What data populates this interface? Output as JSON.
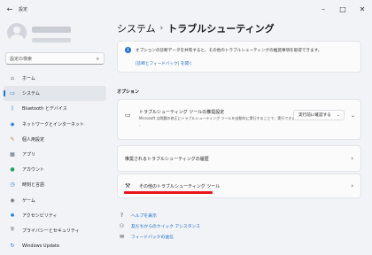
{
  "window": {
    "app_title": "設定",
    "back_glyph": "←",
    "minimize_glyph": "–",
    "maximize_glyph": "□",
    "close_glyph": "✕"
  },
  "sidebar": {
    "search_placeholder": "設定の検索",
    "items": [
      {
        "label": "ホーム",
        "icon": "home-icon",
        "glyph": "⌂",
        "color": "#6b6b6b",
        "active": false
      },
      {
        "label": "システム",
        "icon": "system-icon",
        "glyph": "▭",
        "color": "#1e6fd0",
        "active": true
      },
      {
        "label": "Bluetooth とデバイス",
        "icon": "bluetooth-icon",
        "glyph": "ᛒ",
        "color": "#1e6fd0",
        "active": false
      },
      {
        "label": "ネットワークとインターネット",
        "icon": "network-icon",
        "glyph": "◆",
        "color": "#3a7bd5",
        "active": false
      },
      {
        "label": "個人用設定",
        "icon": "personalization-icon",
        "glyph": "✎",
        "color": "#c77b2a",
        "active": false
      },
      {
        "label": "アプリ",
        "icon": "apps-icon",
        "glyph": "▦",
        "color": "#5a6a7a",
        "active": false
      },
      {
        "label": "アカウント",
        "icon": "account-icon",
        "glyph": "●",
        "color": "#2aa05a",
        "active": false
      },
      {
        "label": "時刻と言語",
        "icon": "time-language-icon",
        "glyph": "◷",
        "color": "#1e6fd0",
        "active": false
      },
      {
        "label": "ゲーム",
        "icon": "gaming-icon",
        "glyph": "◉",
        "color": "#6b6b6b",
        "active": false
      },
      {
        "label": "アクセシビリティ",
        "icon": "accessibility-icon",
        "glyph": "✱",
        "color": "#1e6fd0",
        "active": false
      },
      {
        "label": "プライバシーとセキュリティ",
        "icon": "privacy-shield-icon",
        "glyph": "⛨",
        "color": "#6b6b6b",
        "active": false
      },
      {
        "label": "Windows Update",
        "icon": "windows-update-icon",
        "glyph": "↻",
        "color": "#1e6fd0",
        "active": false
      }
    ]
  },
  "main": {
    "breadcrumb_parent": "システム",
    "breadcrumb_sep": "›",
    "breadcrumb_current": "トラブルシューティング",
    "info": {
      "text": "オプションの診断データを共有すると、その他のトラブルシューティングの推奨事項を取得できます。",
      "link": "[診断とフィードバック] を開く"
    },
    "section_title": "オプション",
    "card1": {
      "title": "トラブルシューティング ツールの推奨設定",
      "desc": "Microsoft は問題の修正にトラブルシューティング ツールを自動的に実行することで、実行できます",
      "desc2": "、",
      "dropdown_value": "実行前に確認する"
    },
    "card2": {
      "title": "推奨されるトラブルシューティングの履歴"
    },
    "card3": {
      "title": "その他のトラブルシューティング ツール"
    },
    "links": [
      {
        "label": "ヘルプを表示",
        "icon": "help-icon",
        "glyph": "?"
      },
      {
        "label": "友だちからのクイック アシスタンス",
        "icon": "quick-assist-icon",
        "glyph": "⚇"
      },
      {
        "label": "フィードバックの送信",
        "icon": "feedback-icon",
        "glyph": "✉"
      }
    ],
    "highlight_color": "#e8141b"
  }
}
